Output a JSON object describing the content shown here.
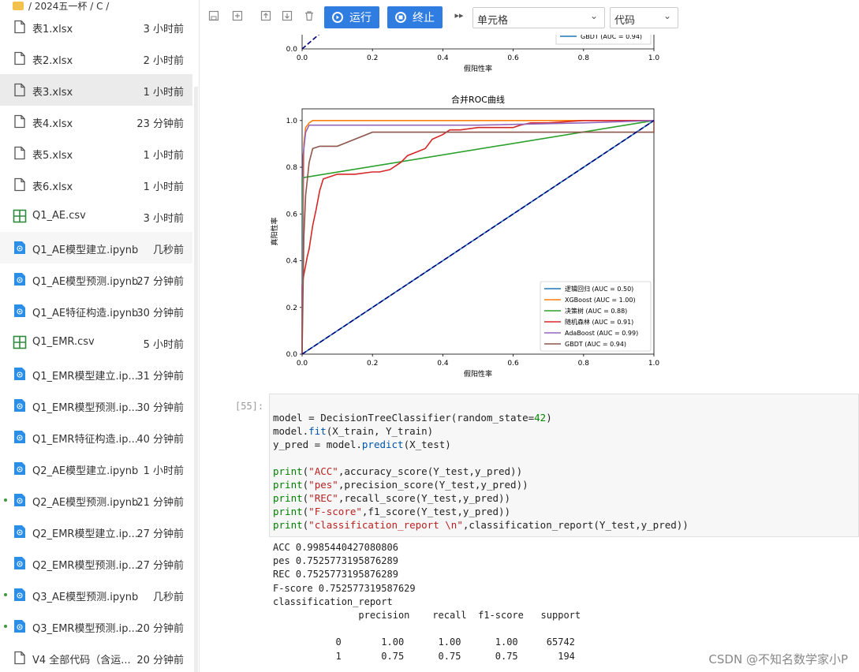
{
  "sidebar": {
    "breadcrumb": "/ 2024五一杯 / C /",
    "files": [
      {
        "name": "表1.xlsx",
        "time": "3 小时前",
        "type": "doc"
      },
      {
        "name": "表2.xlsx",
        "time": "2 小时前",
        "type": "doc"
      },
      {
        "name": "表3.xlsx",
        "time": "1 小时前",
        "type": "doc"
      },
      {
        "name": "表4.xlsx",
        "time": "23 分钟前",
        "type": "doc"
      },
      {
        "name": "表5.xlsx",
        "time": "1 小时前",
        "type": "doc"
      },
      {
        "name": "表6.xlsx",
        "time": "1 小时前",
        "type": "doc"
      },
      {
        "name": "Q1_AE.csv",
        "time": "3 小时前",
        "type": "csv"
      },
      {
        "name": "Q1_AE模型建立.ipynb",
        "time": "几秒前",
        "type": "nb"
      },
      {
        "name": "Q1_AE模型预测.ipynb",
        "time": "27 分钟前",
        "type": "nb"
      },
      {
        "name": "Q1_AE特征构造.ipynb",
        "time": "30 分钟前",
        "type": "nb"
      },
      {
        "name": "Q1_EMR.csv",
        "time": "5 小时前",
        "type": "csv"
      },
      {
        "name": "Q1_EMR模型建立.ip...",
        "time": "31 分钟前",
        "type": "nb"
      },
      {
        "name": "Q1_EMR模型预测.ip...",
        "time": "30 分钟前",
        "type": "nb"
      },
      {
        "name": "Q1_EMR特征构造.ip...",
        "time": "40 分钟前",
        "type": "nb"
      },
      {
        "name": "Q2_AE模型建立.ipynb",
        "time": "1 小时前",
        "type": "nb"
      },
      {
        "name": "Q2_AE模型预测.ipynb",
        "time": "21 分钟前",
        "type": "nb"
      },
      {
        "name": "Q2_EMR模型建立.ip...",
        "time": "27 分钟前",
        "type": "nb"
      },
      {
        "name": "Q2_EMR模型预测.ip...",
        "time": "27 分钟前",
        "type": "nb"
      },
      {
        "name": "Q3_AE模型预测.ipynb",
        "time": "几秒前",
        "type": "nb"
      },
      {
        "name": "Q3_EMR模型预测.ip...",
        "time": "20 分钟前",
        "type": "nb"
      },
      {
        "name": "V4 全部代码（含运...",
        "time": "20 分钟前",
        "type": "doc"
      }
    ]
  },
  "toolbar": {
    "run_label": "运行",
    "stop_label": "终止",
    "cell_type": "单元格",
    "mode": "代码"
  },
  "chart_top": {
    "legend_label": "GBDT (AUC = 0.94)",
    "xlabel": "假阳性率",
    "xticks": [
      "0.0",
      "0.2",
      "0.4",
      "0.6",
      "0.8",
      "1.0"
    ],
    "yticks": [
      "0.0"
    ]
  },
  "chart_data": {
    "type": "line",
    "title": "合并ROC曲线",
    "xlabel": "假阳性率",
    "ylabel": "真阳性率",
    "xlim": [
      0,
      1
    ],
    "ylim": [
      0,
      1.05
    ],
    "xticks": [
      "0.0",
      "0.2",
      "0.4",
      "0.6",
      "0.8",
      "1.0"
    ],
    "yticks": [
      "0.0",
      "0.2",
      "0.4",
      "0.6",
      "0.8",
      "1.0"
    ],
    "legend_position": "lower-right",
    "series": [
      {
        "name": "逻辑回归 (AUC = 0.50)",
        "color": "#1f77b4",
        "x": [
          0,
          1
        ],
        "y": [
          0,
          1
        ]
      },
      {
        "name": "XGBoost (AUC = 1.00)",
        "color": "#ff7f0e",
        "x": [
          0,
          0.005,
          0.01,
          0.02,
          0.03,
          0.4,
          1
        ],
        "y": [
          0,
          0.9,
          0.97,
          0.99,
          1.0,
          1.0,
          1.0
        ]
      },
      {
        "name": "决策树 (AUC = 0.88)",
        "color": "#2ca02c",
        "x": [
          0,
          0,
          1
        ],
        "y": [
          0,
          0.755,
          1.0
        ]
      },
      {
        "name": "随机森林 (AUC = 0.91)",
        "color": "#d62728",
        "x": [
          0,
          0,
          0.005,
          0.01,
          0.015,
          0.02,
          0.03,
          0.04,
          0.05,
          0.06,
          0.08,
          0.1,
          0.15,
          0.2,
          0.22,
          0.25,
          0.28,
          0.3,
          0.35,
          0.37,
          0.4,
          0.42,
          0.45,
          0.5,
          0.6,
          0.62,
          0.65,
          0.7,
          0.8,
          1
        ],
        "y": [
          0,
          0.29,
          0.34,
          0.38,
          0.42,
          0.45,
          0.55,
          0.62,
          0.7,
          0.75,
          0.76,
          0.77,
          0.77,
          0.78,
          0.78,
          0.79,
          0.82,
          0.85,
          0.88,
          0.92,
          0.94,
          0.96,
          0.96,
          0.97,
          0.97,
          0.98,
          0.99,
          0.99,
          1.0,
          1.0
        ]
      },
      {
        "name": "AdaBoost (AUC = 0.99)",
        "color": "#9467bd",
        "x": [
          0,
          0.003,
          0.01,
          0.02,
          0.05,
          0.1,
          0.2,
          0.3,
          0.5,
          0.8,
          1
        ],
        "y": [
          0,
          0.85,
          0.95,
          0.98,
          0.98,
          0.98,
          0.98,
          0.98,
          0.98,
          0.99,
          1.0
        ]
      },
      {
        "name": "GBDT (AUC = 0.94)",
        "color": "#8c564b",
        "x": [
          0,
          0.005,
          0.01,
          0.02,
          0.03,
          0.05,
          0.07,
          0.1,
          0.15,
          0.2,
          0.3,
          1,
          1
        ],
        "y": [
          0,
          0.5,
          0.68,
          0.82,
          0.88,
          0.89,
          0.89,
          0.89,
          0.92,
          0.95,
          0.95,
          0.95,
          1.0
        ]
      }
    ],
    "diagonal": {
      "color": "#000080",
      "dash": true
    }
  },
  "code": {
    "prompt": "[55]:",
    "lines": [
      "model = DecisionTreeClassifier(random_state=42)",
      "model.fit(X_train, Y_train)",
      "y_pred = model.predict(X_test)",
      "",
      "print(\"ACC\",accuracy_score(Y_test,y_pred))",
      "print(\"pes\",precision_score(Y_test,y_pred))",
      "print(\"REC\",recall_score(Y_test,y_pred))",
      "print(\"F-score\",f1_score(Y_test,y_pred))",
      "print(\"classification_report \\n\",classification_report(Y_test,y_pred))"
    ]
  },
  "output": {
    "lines": [
      "ACC 0.9985440427080806",
      "pes 0.7525773195876289",
      "REC 0.7525773195876289",
      "F-score 0.752577319587629",
      "classification_report",
      "               precision    recall  f1-score   support",
      "",
      "           0       1.00      1.00      1.00     65742",
      "           1       0.75      0.75      0.75       194"
    ]
  },
  "watermark": "CSDN @不知名数学家小P"
}
